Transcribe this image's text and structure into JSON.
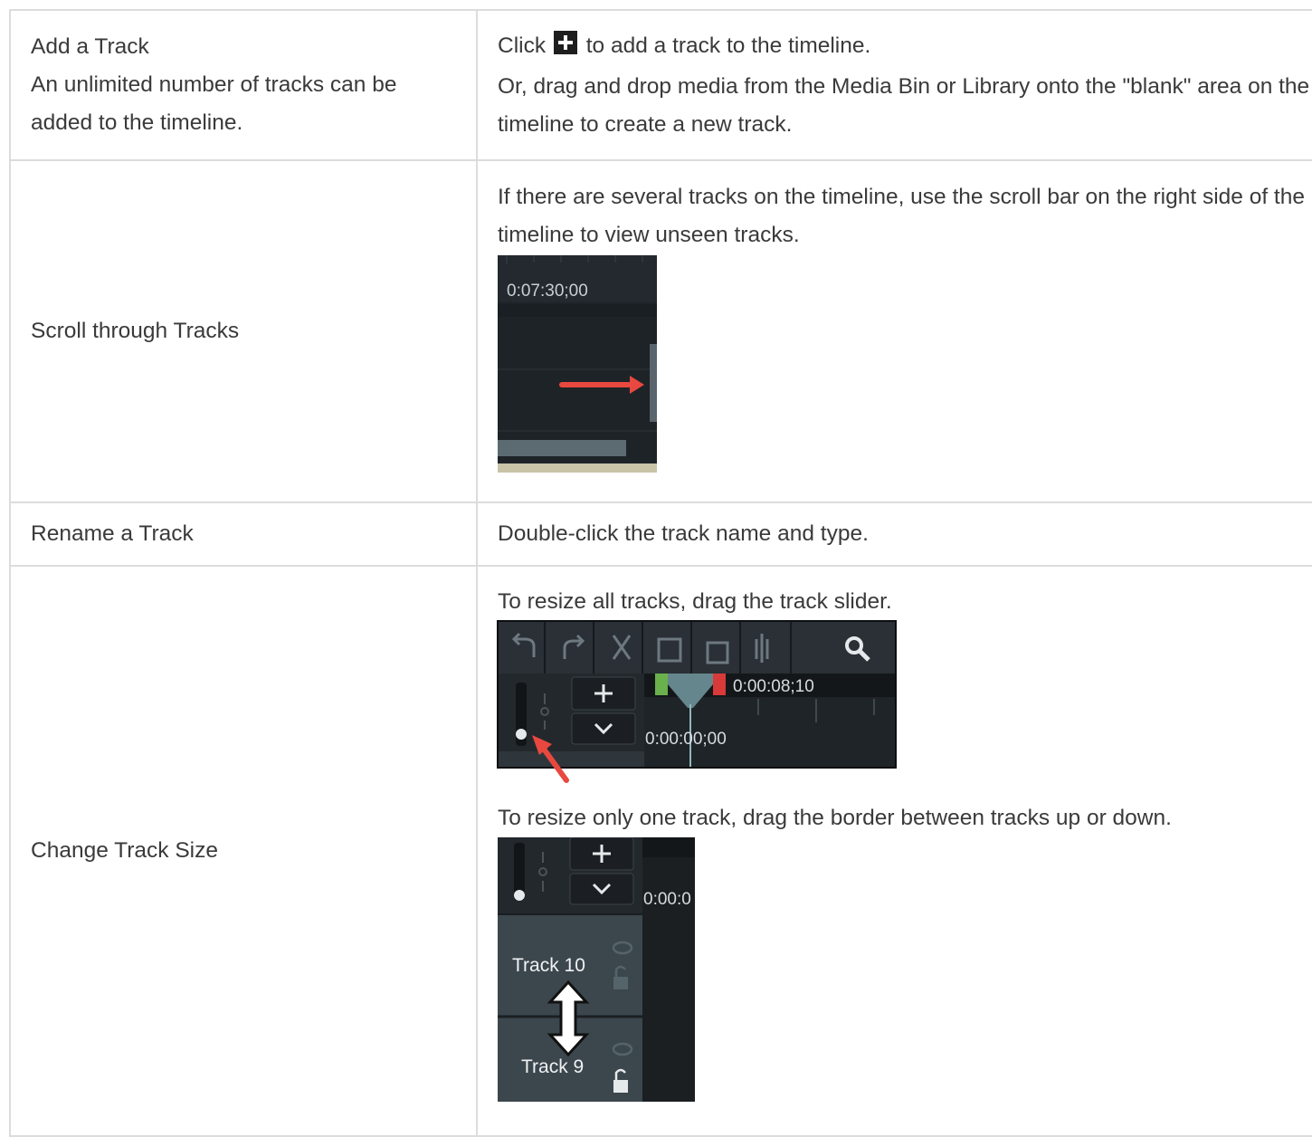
{
  "rows": [
    {
      "title": "Add a Track",
      "subtitle": "An unlimited number of tracks can be added to the timeline.",
      "desc_before_icon": "Click",
      "desc_after_icon": "to add a track to the timeline.",
      "desc_2": "Or, drag and drop media from the Media Bin or Library onto the \"blank\" area on the timeline to create a new track."
    },
    {
      "title": "Scroll through Tracks",
      "desc": "If there are several tracks on the timeline, use the scroll bar on the right side of the timeline to view unseen tracks.",
      "shot_timecode": "0:07:30;00"
    },
    {
      "title": "Rename a Track",
      "desc": "Double-click the track name and type."
    },
    {
      "title": "Change Track Size",
      "desc_1": "To resize all tracks, drag the track slider.",
      "shot1_timecode_top": "0:00:08;10",
      "shot1_timecode_bottom": "0:00:00;00",
      "desc_2": "To resize only one track, drag the border between tracks up or down.",
      "shot2_timecode": "0:00:0",
      "shot2_track_a": "Track 10",
      "shot2_track_b": "Track 9"
    }
  ],
  "icons": [
    "plus-icon",
    "undo-icon",
    "redo-icon",
    "cut-icon",
    "copy-icon",
    "paste-icon",
    "split-icon",
    "zoom-icon",
    "chevron-down-icon",
    "eye-icon",
    "lock-icon",
    "resize-arrow-icon"
  ],
  "colors": {
    "border": "#dcdcdc",
    "text": "#3a3a3a",
    "timeline_bg": "#1c2126",
    "arrow_red": "#e8483f"
  }
}
